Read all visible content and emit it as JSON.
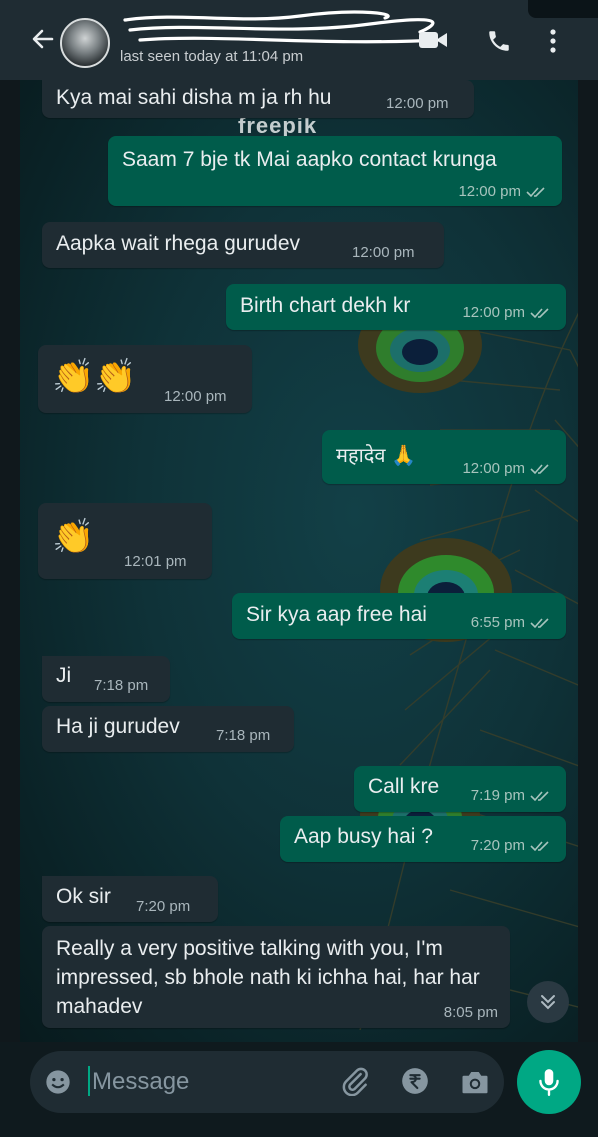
{
  "header": {
    "status": "last seen today at 11:04 pm",
    "icons": [
      "back-arrow-icon",
      "avatar",
      "video-call-icon",
      "voice-call-icon",
      "more-options-icon"
    ]
  },
  "wallpaper": {
    "watermark": "freepik"
  },
  "messages": [
    {
      "dir": "in",
      "text": "Kya mai sahi disha m ja rh hu",
      "time": "12:00 pm"
    },
    {
      "dir": "out",
      "text": "Saam 7 bje tk Mai aapko contact krunga",
      "time": "12:00 pm"
    },
    {
      "dir": "in",
      "text": "Aapka wait rhega gurudev",
      "time": "12:00 pm"
    },
    {
      "dir": "out",
      "text": "Birth chart dekh kr",
      "time": "12:00 pm"
    },
    {
      "dir": "in",
      "text": "👏👏",
      "time": "12:00 pm"
    },
    {
      "dir": "out",
      "text": "महादेव 🙏",
      "time": "12:00 pm"
    },
    {
      "dir": "in",
      "text": "👏",
      "time": "12:01 pm"
    },
    {
      "dir": "out",
      "text": "Sir kya aap free hai",
      "time": "6:55 pm"
    },
    {
      "dir": "in",
      "text": "Ji",
      "time": "7:18 pm"
    },
    {
      "dir": "in",
      "text": "Ha ji gurudev",
      "time": "7:18 pm"
    },
    {
      "dir": "out",
      "text": "Call kre",
      "time": "7:19 pm"
    },
    {
      "dir": "out",
      "text": "Aap busy hai ?",
      "time": "7:20 pm"
    },
    {
      "dir": "in",
      "text": "Ok sir",
      "time": "7:20 pm"
    },
    {
      "dir": "in",
      "text": "Really a very positive talking with you, I'm impressed, sb bhole nath ki ichha hai, har har mahadev",
      "time": "8:05 pm"
    }
  ],
  "composer": {
    "placeholder": "Message",
    "icons": [
      "emoji-icon",
      "attach-icon",
      "rupee-payment-icon",
      "camera-icon",
      "mic-icon"
    ]
  },
  "colors": {
    "header_bg": "#1f2c33",
    "incoming_bubble": "#1f2c33",
    "outgoing_bubble": "#005c4b",
    "accent": "#00a884",
    "read_tick": "#a7c4bd"
  }
}
